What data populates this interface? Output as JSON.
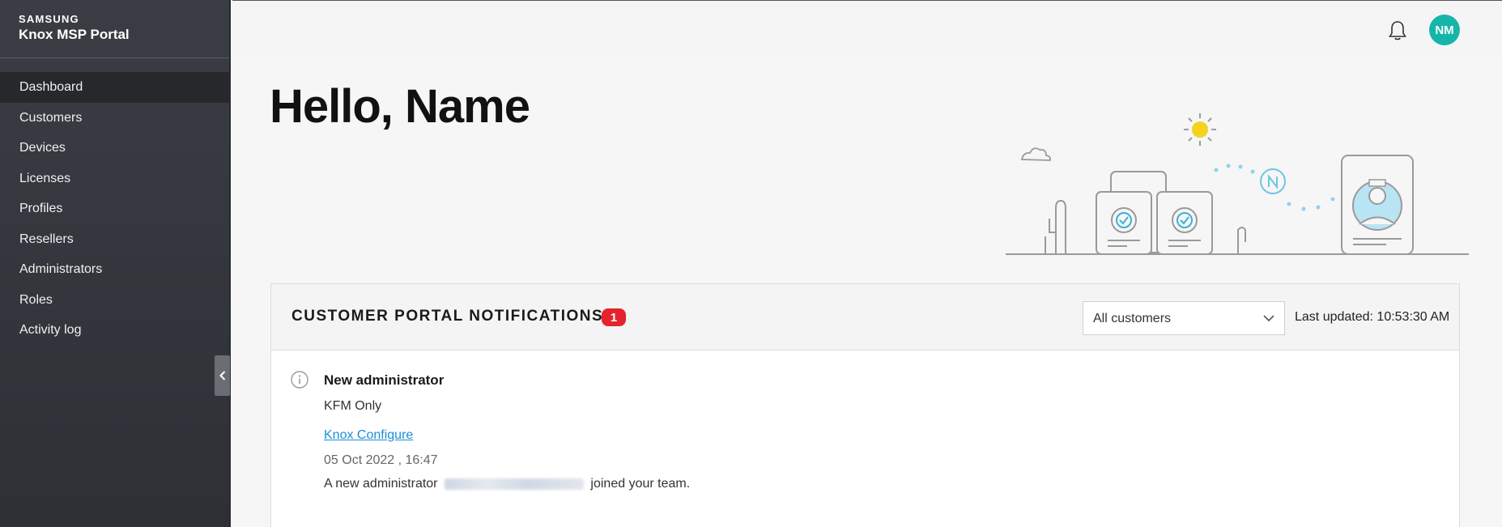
{
  "brand": {
    "maker": "SAMSUNG",
    "product": "Knox MSP Portal"
  },
  "nav": {
    "items": [
      {
        "label": "Dashboard",
        "active": true
      },
      {
        "label": "Customers"
      },
      {
        "label": "Devices"
      },
      {
        "label": "Licenses"
      },
      {
        "label": "Profiles"
      },
      {
        "label": "Resellers"
      },
      {
        "label": "Administrators"
      },
      {
        "label": "Roles"
      },
      {
        "label": "Activity log"
      }
    ]
  },
  "topbar": {
    "avatar_initials": "NM",
    "bell_icon": "bell-icon"
  },
  "main": {
    "greeting": "Hello, Name"
  },
  "notifications": {
    "title": "CUSTOMER PORTAL NOTIFICATIONS",
    "count": "1",
    "filter_value": "All customers",
    "last_updated": "Last updated: 10:53:30 AM",
    "items": [
      {
        "title": "New administrator",
        "company": "KFM Only",
        "link": "Knox Configure",
        "date": "05 Oct 2022 , 16:47",
        "message_prefix": "A new administrator",
        "message_suffix": "joined your team."
      }
    ]
  },
  "colors": {
    "accent": "#15b6a9",
    "badge": "#e4232e",
    "link": "#1a8fd6",
    "sidebar": "#35383e"
  }
}
